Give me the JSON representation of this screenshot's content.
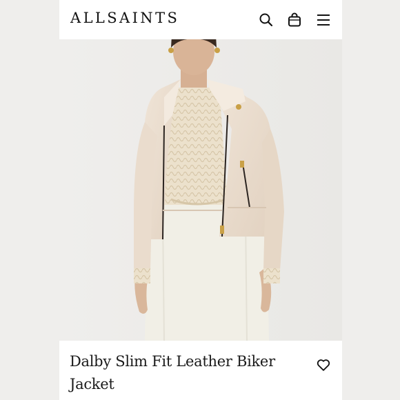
{
  "header": {
    "logo": "ALLSAINTS",
    "icons": [
      "search-icon",
      "bag-icon",
      "menu-icon"
    ]
  },
  "product": {
    "title": "Dalby Slim Fit Leather Biker Jacket",
    "image_alt": "Model wearing cream leather biker jacket over knit top and white skirt",
    "wishlist_icon": "heart-icon"
  },
  "colors": {
    "page_bg": "#efeeec",
    "photo_bg": "#ecebe9",
    "jacket": "#eadccd",
    "text": "#1a1a1a"
  }
}
